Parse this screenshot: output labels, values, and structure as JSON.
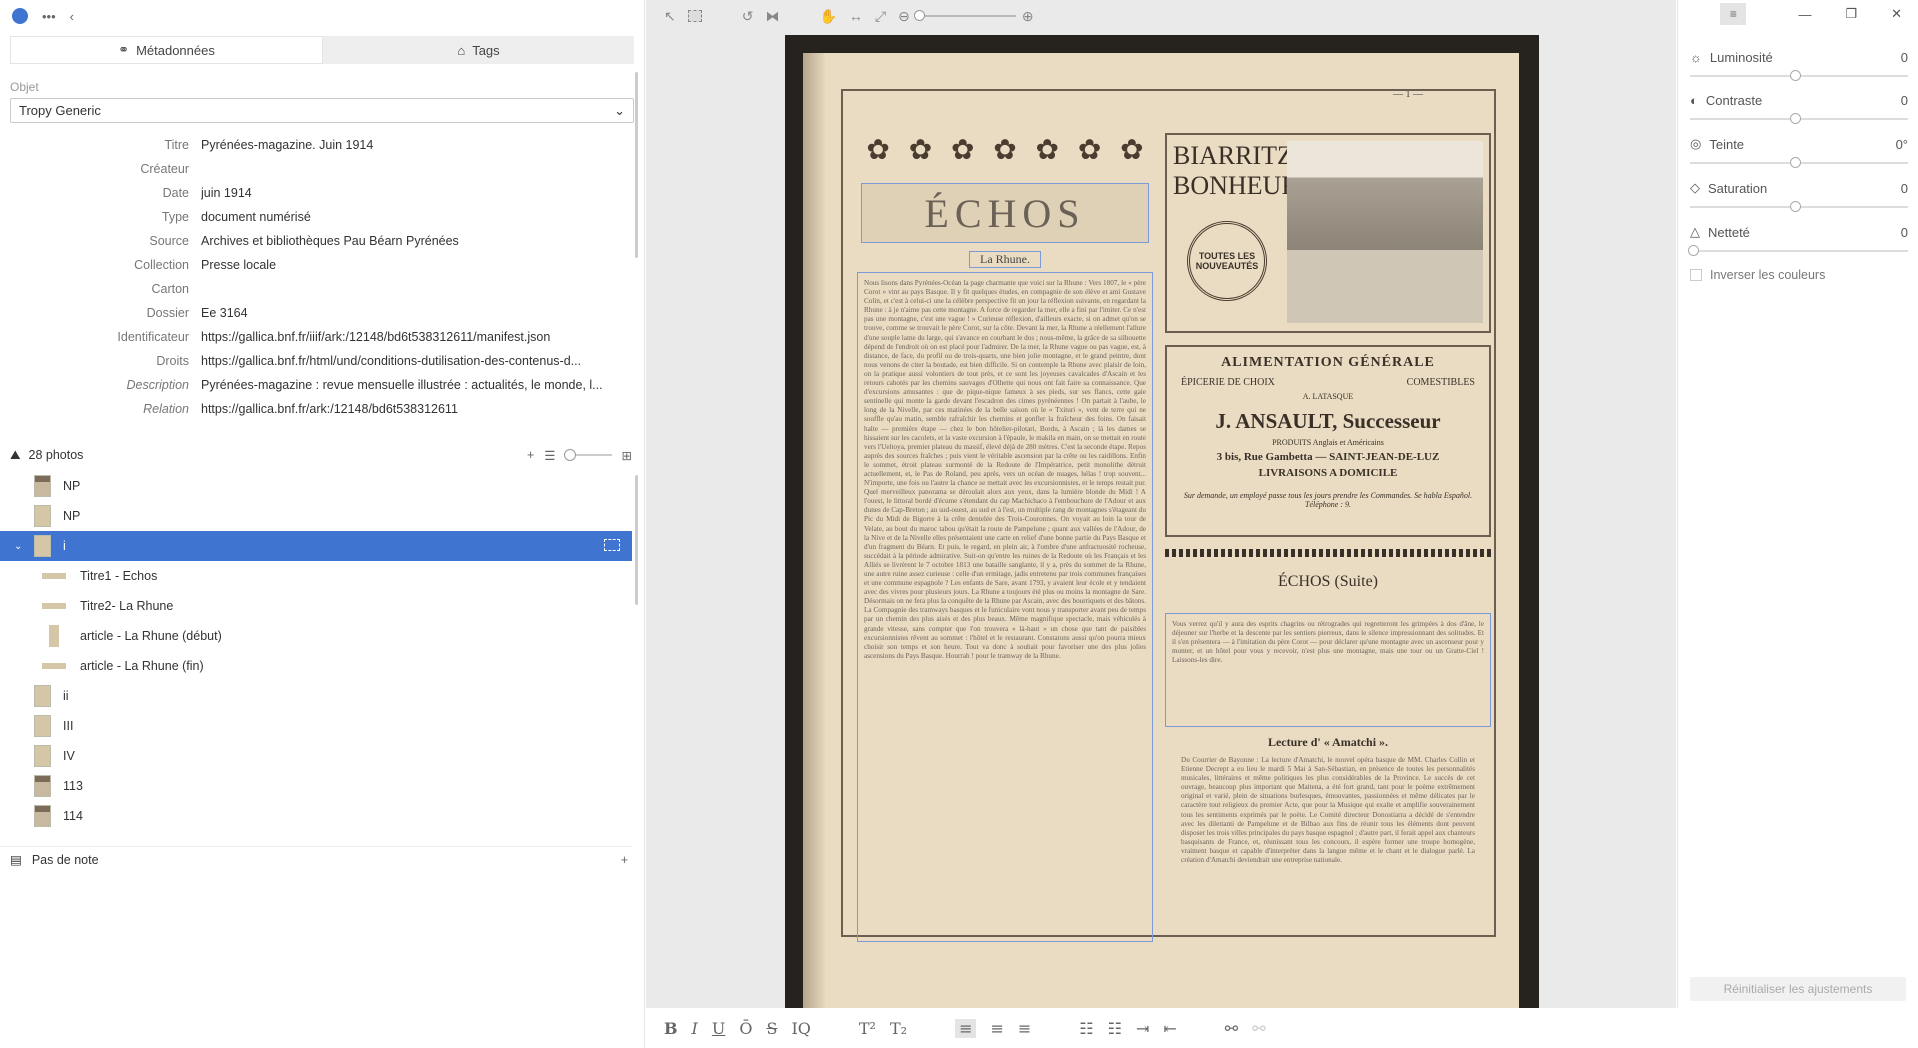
{
  "left": {
    "tabs": [
      {
        "label": "Métadonnées"
      },
      {
        "label": "Tags"
      }
    ],
    "object_label": "Objet",
    "template": "Tropy Generic",
    "metadata": [
      {
        "label": "Titre",
        "value": "Pyrénées-magazine. Juin 1914"
      },
      {
        "label": "Créateur",
        "value": ""
      },
      {
        "label": "Date",
        "value": "juin 1914"
      },
      {
        "label": "Type",
        "value": "document numérisé"
      },
      {
        "label": "Source",
        "value": "Archives et bibliothèques Pau Béarn Pyrénées"
      },
      {
        "label": "Collection",
        "value": "Presse locale"
      },
      {
        "label": "Carton",
        "value": ""
      },
      {
        "label": "Dossier",
        "value": "Ee 3164"
      },
      {
        "label": "Identificateur",
        "value": "https://gallica.bnf.fr/iiif/ark:/12148/bd6t538312611/manifest.json"
      },
      {
        "label": "Droits",
        "value": "https://gallica.bnf.fr/html/und/conditions-dutilisation-des-contenus-d..."
      },
      {
        "label": "Description",
        "value": "Pyrénées-magazine : revue mensuelle illustrée : actualités, le monde, l..."
      },
      {
        "label": "Relation",
        "value": "https://gallica.bnf.fr/ark:/12148/bd6t538312611"
      }
    ],
    "photos_count": "28 photos",
    "photos": [
      {
        "label": "NP"
      },
      {
        "label": "NP"
      },
      {
        "label": "i"
      }
    ],
    "selections": [
      {
        "label": "Titre1 - Echos"
      },
      {
        "label": "Titre2- La Rhune"
      },
      {
        "label": "article - La Rhune (début)"
      },
      {
        "label": "article - La Rhune (fin)"
      }
    ],
    "photos_after": [
      {
        "label": "ii"
      },
      {
        "label": "III"
      },
      {
        "label": "IV"
      },
      {
        "label": "113"
      },
      {
        "label": "114"
      }
    ],
    "notes": "Pas de note"
  },
  "viewer": {
    "page_number": "— 1 —",
    "echos_title": "ÉCHOS",
    "rhune_title": "La Rhune.",
    "article_text": "Nous lisons dans Pyrénées-Océan la page charmante que voici sur la Rhune : Vers 1807, le « père Corot » vint au pays Basque. Il y fit quelques études, en compagnie de son élève et ami Gustave Colin, et c'est à celui-ci une la célèbre perspective fit un jour la réflexion suivante, en regardant la Rhune : à je n'aime pas cette montagne. A force de regarder la mer, elle a fini par l'imiter. Ce n'est pas une montagne, c'est une vague ! » Curieuse réflexion, d'ailleurs exacte, si on admet qu'on se trouve, comme se trouvait le père Corot, sur la côte. Devant la mer, la Rhune a réellement l'allure d'une souple lame du large, qui s'avance en courbant le dos ; nous-même, la grâce de sa silhouette dépend de l'endroit où on est placé pour l'admirer. De la mer, la Rhune vague ou pas vague, est, à distance, de face, du profil ou de trois-quarts, une bien jolie montagne, et le grand peintre, dont nous venons de citer la boutade, est bien difficile. Si on contemple la Rhune avec plaisir de loin, on la pratique aussi volontiers de tout près, et ce sont les joyeuses cavalcades d'Ascain et les retours cahotés par les chemins sauvages d'Olhette qui nous ont fait faire sa connaissance. Que d'excursions amusantes : que de pique-nique fameux à ses pieds, sur ses flancs, cette gaie sentinelle qui monte la garde devant l'escadron des cimes pyrénéennes ! On partait à l'aube, le long de la Nivelle, par ces matinées de la belle saison où le « Txituri », vent de terre qui ne souffle qu'au matin, semble rafraîchir les chemins et gonfler la fraîcheur des foins. On faisait halte — première étape — chez le bon hôtelier-pilotari, Bordu, à Ascain ; là les dames se hissaient sur les cacolets, et la vaste excursion à l'épaule, le makila en main, on se mettait en route vers l'Ueltoya, premier plateau du massif, élevé déjà de 280 mètres. C'est la seconde étape. Repos auprès des sources fraîches ; puis vient le véritable ascension par la crête ou les raidillons. Enfin le sommet, étroit plateau surmonté de la Redoute de l'Impératrice, petit monolithe détruit actuellement, et, le Pas de Roland, peu après, vers un océan de nuages, hélas ! trop souvent... N'importe, une fois ou l'autre la chance se mettait avec les excursionnistes, et le temps restait pur. Quel merveilleux panorama se déroulait alors aux yeux, dans la lumière blonde du Midi ! A l'ouest, le littoral bordé d'écume s'étendant du cap Machichaco à l'embouchure de l'Adour et aux dunes de Cap-Breton ; au sud-ouest, au sud et à l'est, un multiple rang de montagnes s'étageant du Pic du Midi de Bigorre à la crête dentelée des Trois-Couronnes. On voyait au loin la tour de Velate, au bout du maroc tabou qu'était la route de Pampelune ; quant aux vallées de l'Adour, de la Nive et de la Nivelle elles présentaient une carte en relief d'une bonne partie du Pays Basque et d'un fragment du Béarn. Et puis, le regard, en plein air, à l'ombre d'une anfractuosité rocheuse, succédait à la période admirative. Suit-on qu'entre les ruines de la Redoute où les Français et les Alliés se livrèrent le 7 octobre 1813 une bataille sanglante, il y a, près du sommet de la Rhune, une autre ruine assez curieuse : celle d'un ermitage, jadis entretenu par trois communes françaises et une commune espagnole ? Les enfants de Sare, avant 1793, y avaient leur école et y tendaient avec des vivres pour plusieurs jours. La Rhune a toujours été plus ou moins la montagne de Sare. Désormais on ne fera plus la conquête de la Rhune par Ascain, avec des bourriquets et des bâtons. La Compagnie des tramways basques et le funiculaire vont nous y transporter avant peu de temps par un chemin des plus aisés et des plus beaux. Même magnifique spectacle, mais véhiculés à grande vitesse, sans compter que l'on trouvera « là-haut » un chose que tant de paisibles excursionnistes rêvent au sommet : l'hôtel et le restaurant. Constatons aussi qu'on pourra mieux choisir son temps et son heure. Tout va donc à souhait pour favoriser une des plus jolies ascensions du Pays Basque. Hourrah ! pour le tramway de la Rhune.",
    "ad1_title": "BIARRITZ-BONHEUR",
    "ad1_seal": "TOUTES LES NOUVEAUTÉS",
    "ad2_line1": "ALIMENTATION GÉNÉRALE",
    "ad2_left": "ÉPICERIE DE CHOIX",
    "ad2_right": "COMESTIBLES",
    "ad2_small": "A. LATASQUE",
    "ad2_name": "J. ANSAULT, Successeur",
    "ad2_addr": "3 bis, Rue Gambetta — SAINT-JEAN-DE-LUZ",
    "ad2_produits": "PRODUITS Anglais et Américains",
    "ad2_livraisons": "LIVRAISONS A DOMICILE",
    "ad2_note": "Sur demande, un employé passe tous les jours prendre les Commandes. Se habla Español. Téléphone : 9.",
    "echos_suite": "ÉCHOS (Suite)",
    "suite_text": "Vous verrez qu'il y aura des esprits chagrins ou rétrogrades qui regretteront les grimpées à dos d'âne, le déjeuner sur l'herbe et la descente par les sentiers pierreux, dans le silence impressionnant des solitudes. Et il s'en présentera — à l'imitation du père Corot — pour déclarer qu'une montagne avec un ascenseur pour y monter, et un hôtel pour vous y recevoir, n'est plus une montagne, mais une tour ou un Gratte-Ciel ! Laissons-les dire.",
    "lecture_title": "Lecture d' « Amatchi ».",
    "lecture_text": "Du Courrier de Bayonne : La lecture d'Amatchi, le nouvel opéra basque de MM. Charles Collin et Etienne Decrept a eu lieu le mardi 5 Mai à San-Sébastian, en présence de toutes les personnalités musicales, littéraires et même politiques les plus considérables de la Province. Le succès de cet ouvrage, beaucoup plus important que Maitena, a été fort grand, tant pour le poème extrêmement original et varié, plein de situations burlesques, émouvantes, passionnées et même délicates par le caractère tout religieux du premier Acte, que pour la Musique qui exalte et amplifie souverainement tous les sentiments exprimés par le poète. Le Comité directeur Donostiarra a décidé de s'entendre avec les dilettanti de Pampelune et de Bilbao aux fins de réunir tous les éléments dont peuvent disposer les trois villes principales du pays basque espagnol ; d'autre part, il ferait appel aux chanteurs basquisants de France, et, réunissant tous les concours, il espère former une troupe homogène, vraiment basque et capable d'interpréter dans la langue même et le chant et le dialogue parlé. La création d'Amatchi deviendrait une entreprise nationale."
  },
  "adjust": {
    "rows": [
      {
        "label": "Luminosité",
        "value": "0"
      },
      {
        "label": "Contraste",
        "value": "0"
      },
      {
        "label": "Teinte",
        "value": "0°"
      },
      {
        "label": "Saturation",
        "value": "0"
      },
      {
        "label": "Netteté",
        "value": "0"
      }
    ],
    "invert": "Inverser les couleurs",
    "reset": "Réinitialiser les ajustements"
  },
  "format_bar": [
    "B",
    "I",
    "U",
    "Ō",
    "S",
    "IQ",
    "T²",
    "T₂"
  ]
}
